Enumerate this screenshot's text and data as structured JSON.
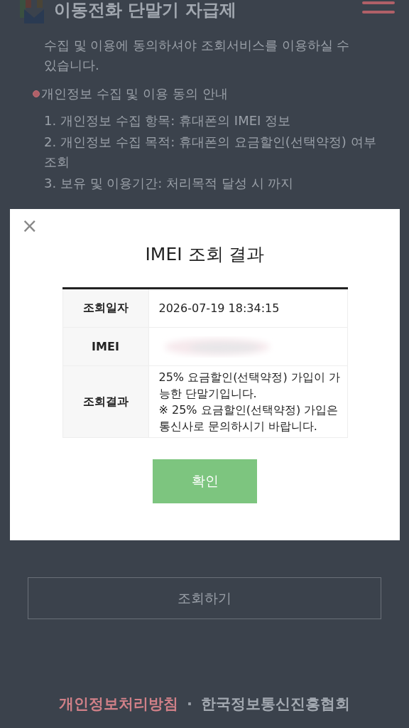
{
  "header": {
    "title": "이동전화 단말기 자급제"
  },
  "notice": "수집 및 이용에 동의하셔야 조회서비스를 이용하실 수 있습니다.",
  "section_title": "개인정보 수집 및 이용 동의 안내",
  "items": [
    "1. 개인정보 수집 항목: 휴대폰의 IMEI 정보",
    "2. 개인정보 수집 목적: 휴대폰의 요금할인(선택약정) 여부 조회",
    "3. 보유 및 이용기간: 처리목적 달성 시 까지"
  ],
  "lookup_button": "조회하기",
  "footer_links": [
    {
      "label": "개인정보처리방침",
      "kind": "highlight"
    },
    {
      "label": "한국정보통신진흥협회",
      "kind": "plain"
    }
  ],
  "footer_separator": "·",
  "modal": {
    "close": "×",
    "title": "IMEI 조회 결과",
    "rows": [
      {
        "label": "조회일자",
        "kind": "text",
        "lines": [
          "2026-07-19 18:34:15"
        ]
      },
      {
        "label": "IMEI",
        "kind": "redacted"
      },
      {
        "label": "조회결과",
        "kind": "text",
        "lines": [
          "25% 요금할인(선택약정) 가입이 가능한 단말기입니다.",
          "※ 25% 요금할인(선택약정) 가입은 통신사로 문의하시기 바랍니다."
        ]
      }
    ],
    "confirm": "확인"
  }
}
